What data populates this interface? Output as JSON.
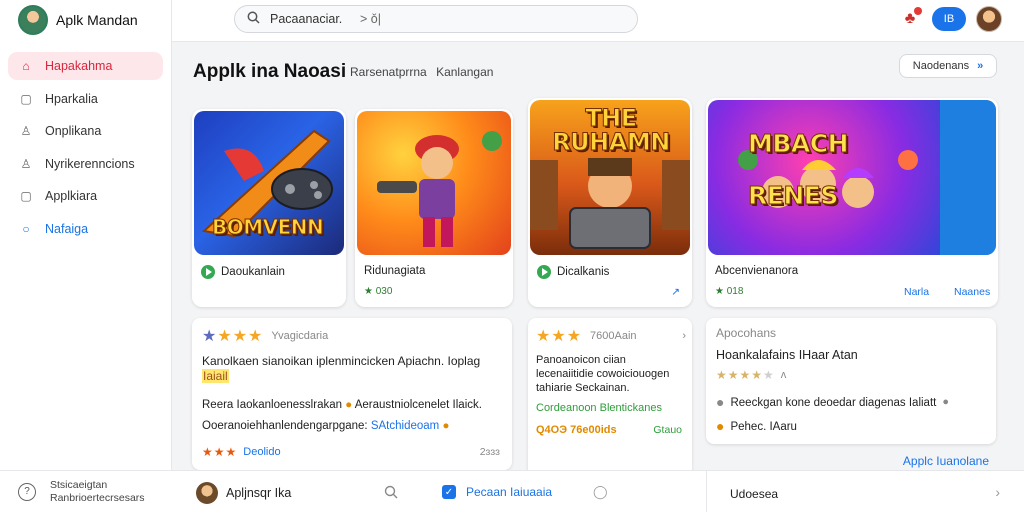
{
  "brand": {
    "name": "Aplk Mandan"
  },
  "sidebar": {
    "items": [
      {
        "label": "Hapakahma",
        "icon": "home-icon",
        "glyph": "⌂"
      },
      {
        "label": "Hparkalia",
        "icon": "apps-icon",
        "glyph": "▢"
      },
      {
        "label": "Onplikana",
        "icon": "user-icon",
        "glyph": "♙"
      },
      {
        "label": "Nyrikerenncions",
        "icon": "account-icon",
        "glyph": "♙"
      },
      {
        "label": "Applkiara",
        "icon": "library-icon",
        "glyph": "▢"
      },
      {
        "label": "Nafaiga",
        "icon": "chat-icon",
        "glyph": "○"
      }
    ]
  },
  "search": {
    "value": "Pacaanaciar.",
    "placeholder": "Pacaanaciar.",
    "right_text": "> ǒ|"
  },
  "topbar": {
    "pill_label": "ІΒ"
  },
  "main": {
    "title": "Applk ina Naoasi",
    "subtitle": [
      "Rarsenatprrna",
      "Kanlangan"
    ],
    "view_all": "Naodenans"
  },
  "apps": [
    {
      "art_title": "BOMVENN",
      "name": "Daoukanlain",
      "meta": "",
      "link": "",
      "has_play": true
    },
    {
      "art_title": "",
      "name": "Ridunagiata",
      "meta": "★ 030",
      "link": "",
      "has_play": false
    },
    {
      "art_title": "THE RUHAMN",
      "name": "Dicalkanis",
      "meta": "",
      "link": "↗",
      "has_play": true
    },
    {
      "art_title": "MBACH RENES",
      "name": "Abcenvienanora",
      "meta": "★ 018",
      "link": "Narla",
      "link2": "Naanes",
      "has_play": false
    }
  ],
  "reviews": [
    {
      "stars": "★★★",
      "reviewer": "Yvagicdaria",
      "headline": "Kanolkaen sianoikan iplenmincicken Apiachn. Ioplag",
      "highlight": "Iaiail",
      "body": "Reera Iaokanloenesslrakan",
      "body_tail": "Aeraustniolcenelet Ilaick.",
      "line3": "Ooeranoiehhanlendengarpgane:",
      "line3_tail": "SAtchideoam",
      "footer_stars": "★★★",
      "footer_text": "Deolido",
      "footer_right": "2ɜɜɜ"
    },
    {
      "stars": "★★★",
      "reviewer": "7600Aain",
      "headline": "Panoanoicon ciian lecenaiitidie cowoiciouogen tahiarie Seckainan.",
      "line2": "Cordeanoon Blentickanes",
      "footer_text": "Q4OЭ 76e00ids",
      "footer_right": "Gtauo"
    },
    {
      "title": "Apocohans",
      "headline": "Hoankalafains IHaar Atan",
      "stars": "★★★★",
      "reviewer": "ʌ",
      "line1": "Reeckgan kone deoedar diagenas Ialiatt",
      "line2": "Pehec. IAaru"
    }
  ],
  "more_link": "Applc Iuanolane",
  "bottom": {
    "help_lines": [
      "Stsicaeigtan",
      "Ranbrioertecrsesars"
    ],
    "user_name": "Apljnsqr Ika",
    "mid_label": "Pecaan Iaiuaaia",
    "right_label": "Udoesea"
  }
}
